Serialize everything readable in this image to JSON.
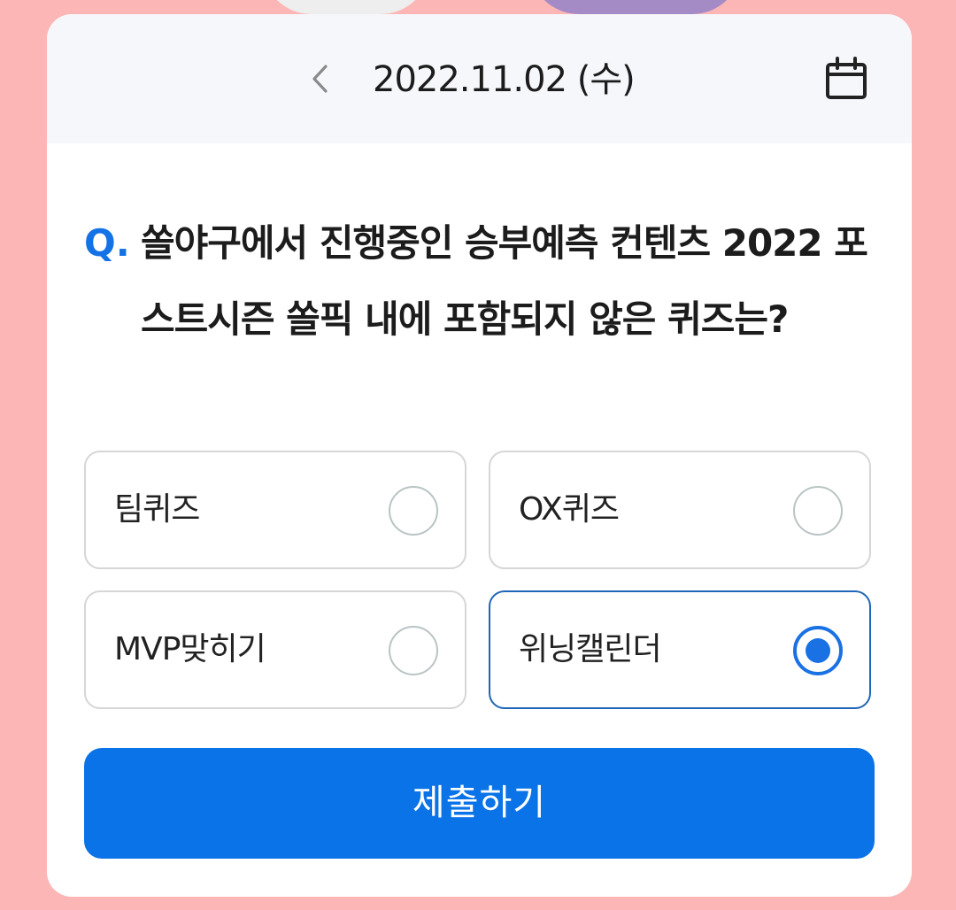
{
  "header": {
    "date": "2022.11.02 (수)",
    "prev_icon": "chevron-left-icon",
    "calendar_icon": "calendar-icon"
  },
  "question": {
    "prefix": "Q.",
    "text": "쏠야구에서 진행중인 승부예측 컨텐츠 2022 포스트시즌 쏠픽 내에 포함되지 않은 퀴즈는?"
  },
  "options": [
    {
      "label": "팀퀴즈",
      "selected": false
    },
    {
      "label": "OX퀴즈",
      "selected": false
    },
    {
      "label": "MVP맞히기",
      "selected": false
    },
    {
      "label": "위닝캘린더",
      "selected": true
    }
  ],
  "submit": {
    "label": "제출하기"
  },
  "colors": {
    "background": "#fdb6b6",
    "accent": "#0a73e8",
    "question_prefix": "#1372e6",
    "selected_border": "#1f66b8"
  }
}
